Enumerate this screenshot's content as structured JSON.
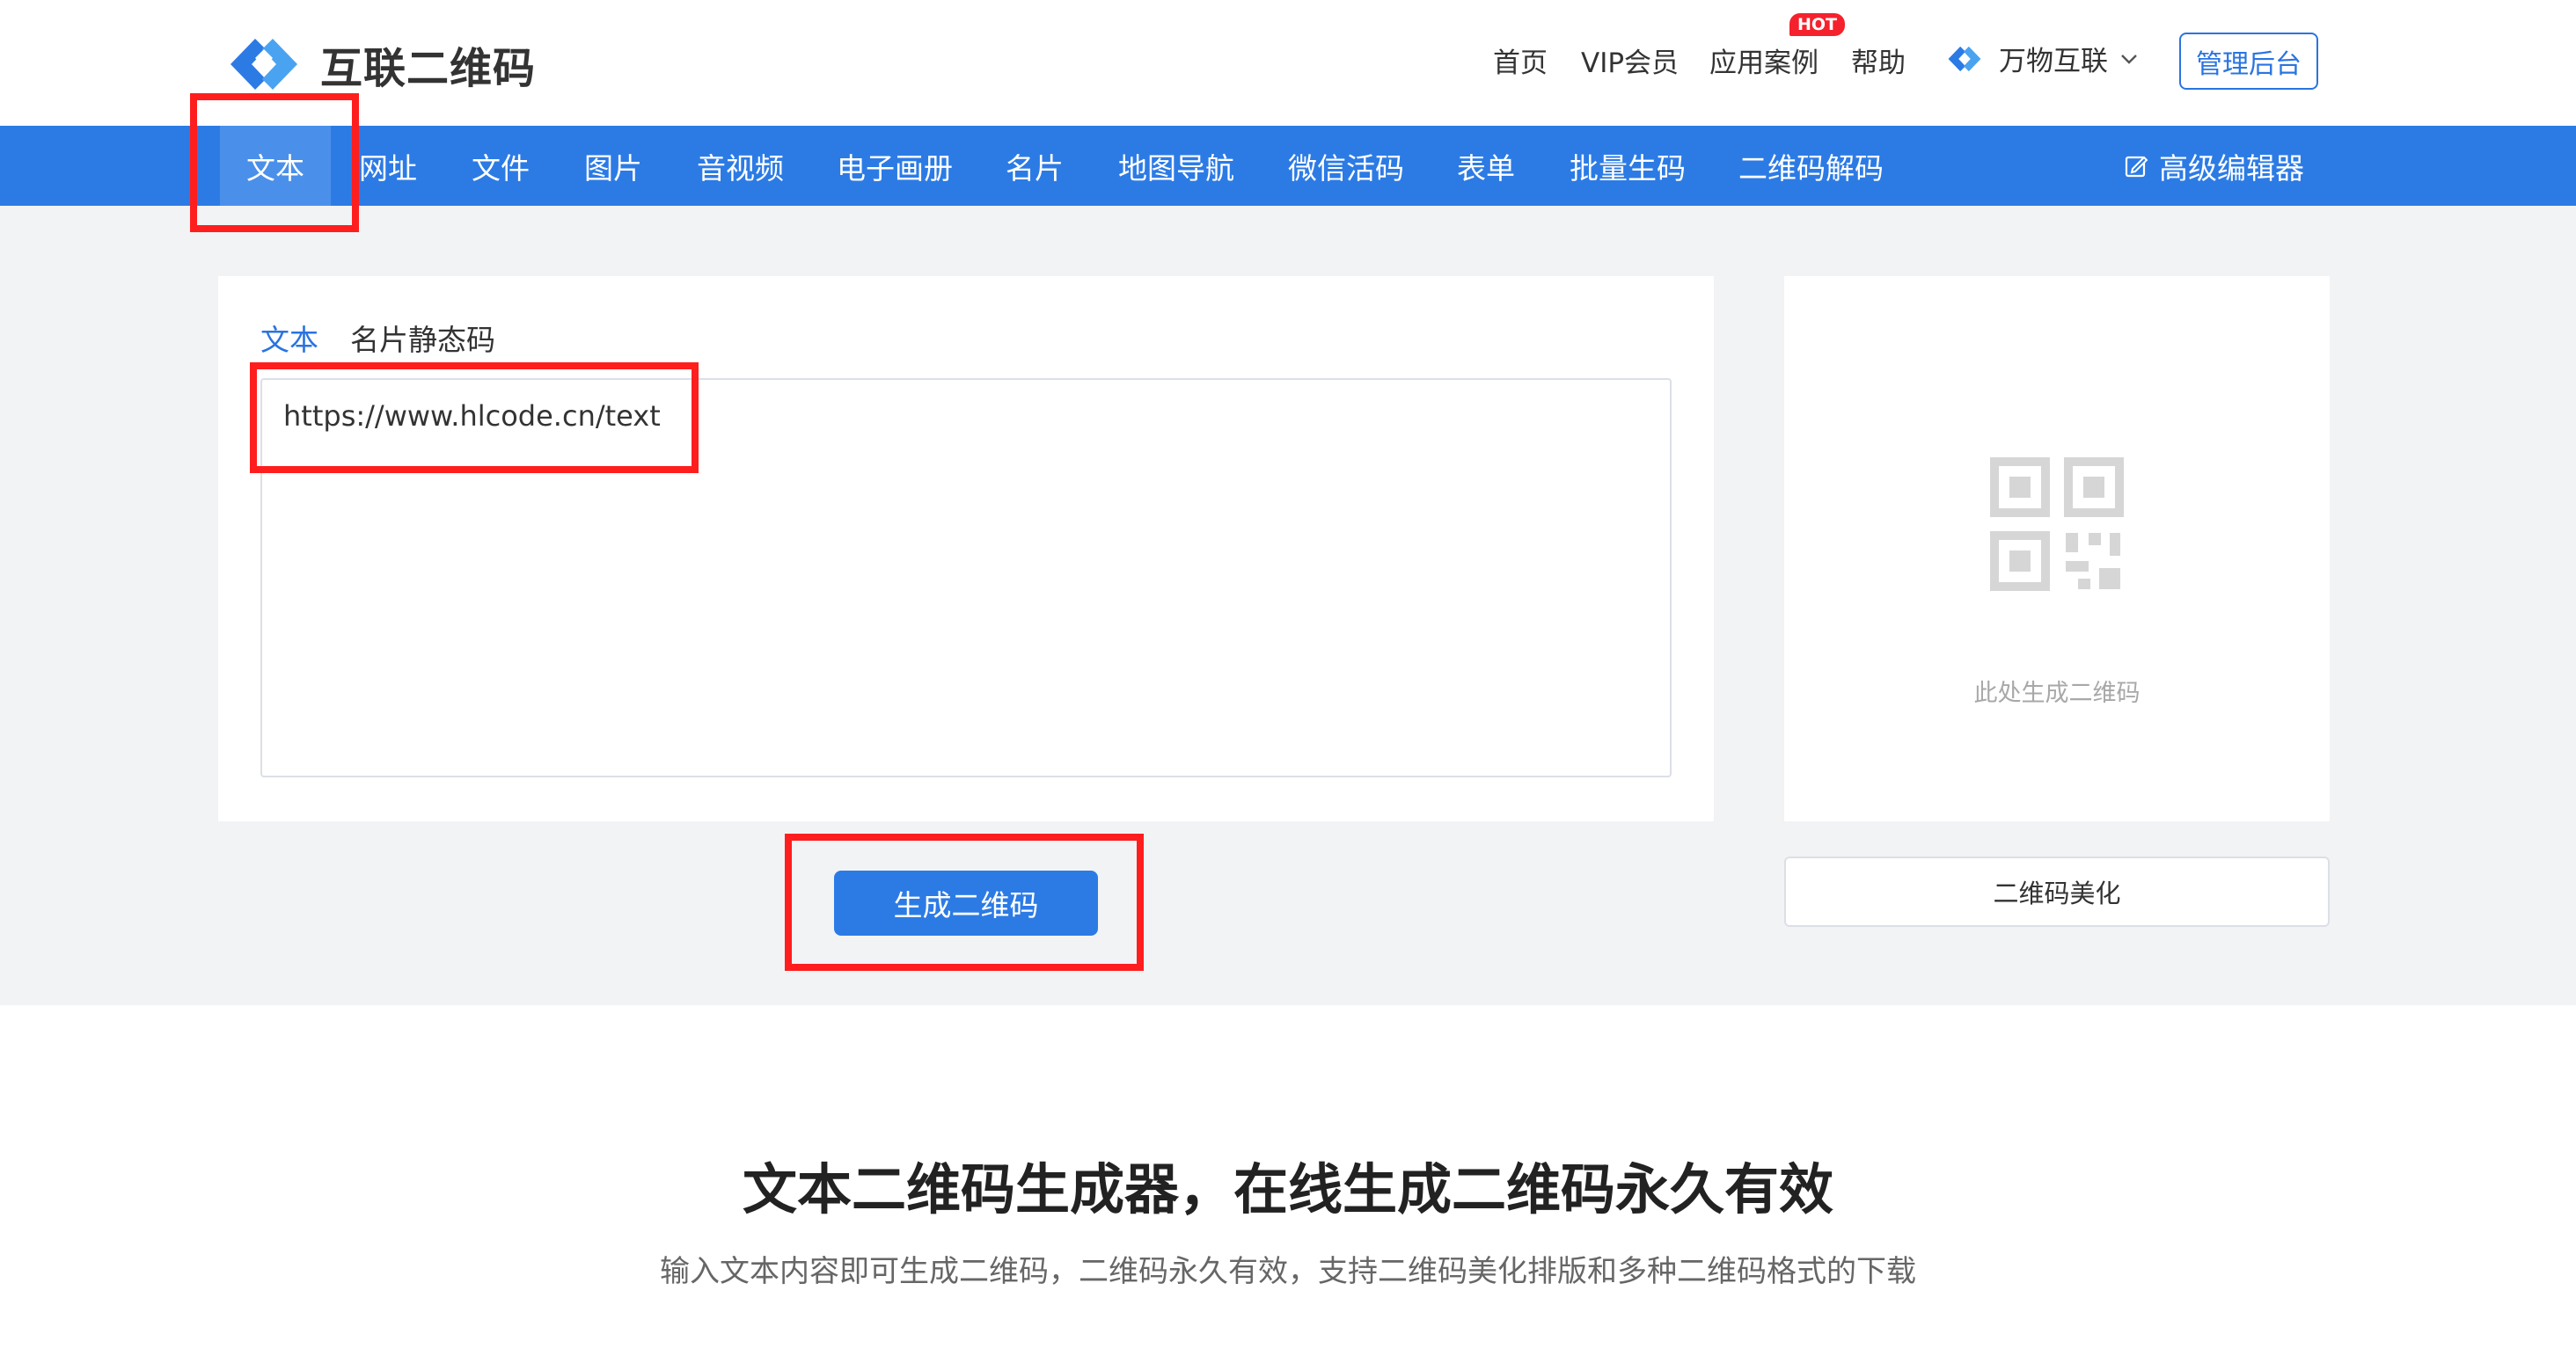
{
  "header": {
    "logo_text": "互联二维码",
    "nav": [
      "首页",
      "VIP会员",
      "应用案例",
      "帮助"
    ],
    "hot_badge": "HOT",
    "brand_menu": "万物互联",
    "admin_button": "管理后台"
  },
  "navbar": {
    "tabs": [
      "文本",
      "网址",
      "文件",
      "图片",
      "音视频",
      "电子画册",
      "名片",
      "地图导航",
      "微信活码",
      "表单",
      "批量生码",
      "二维码解码"
    ],
    "active_tab": "文本",
    "advanced_editor": "高级编辑器"
  },
  "editor": {
    "subtabs": [
      "文本",
      "名片静态码"
    ],
    "active_subtab": "文本",
    "text_value": "https://www.hlcode.cn/text",
    "generate_button": "生成二维码"
  },
  "preview": {
    "placeholder_label": "此处生成二维码",
    "beautify_button": "二维码美化"
  },
  "intro": {
    "title": "文本二维码生成器，在线生成二维码永久有效",
    "subtitle": "输入文本内容即可生成二维码，二维码永久有效，支持二维码美化排版和多种二维码格式的下载"
  },
  "colors": {
    "brand_blue": "#2c7be5",
    "annotation_red": "#ff1e1e",
    "hot_red": "#f5222d"
  },
  "icons": {
    "logo": "chain-link-logo-icon",
    "advanced_editor": "edit-icon",
    "brand_menu": "chevron-down-icon",
    "qr_placeholder": "qr-code-icon"
  }
}
